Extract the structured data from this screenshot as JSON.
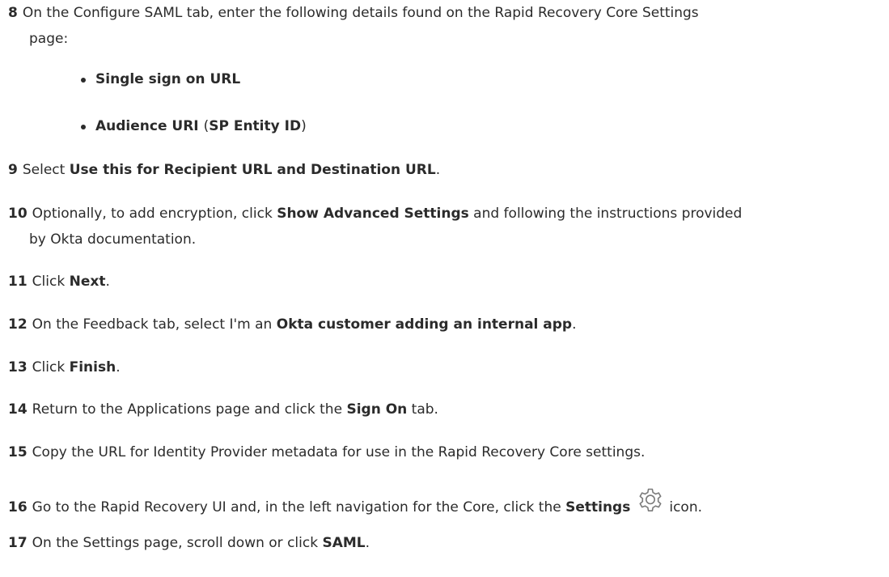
{
  "steps": {
    "s8": {
      "num": "8",
      "text": "On the Configure SAML tab, enter the following details found on the Rapid Recovery Core Settings",
      "cont": "page:"
    },
    "b1": {
      "text": "Single sign on URL"
    },
    "b2": {
      "pre": "Audience URI ",
      "paren_open": "(",
      "bold": "SP Entity ID",
      "paren_close": ")"
    },
    "s9": {
      "num": "9",
      "pre": "Select ",
      "bold": "Use this for Recipient URL and Destination URL",
      "post": "."
    },
    "s10": {
      "num": "10",
      "pre": "Optionally, to add encryption, click ",
      "bold": "Show Advanced Settings",
      "post": " and following the instructions provided",
      "cont": "by Okta documentation."
    },
    "s11": {
      "num": "11",
      "pre": "Click ",
      "bold": "Next",
      "post": "."
    },
    "s12": {
      "num": "12",
      "pre": "On the Feedback tab, select I'm an ",
      "bold": "Okta customer adding an internal app",
      "post": "."
    },
    "s13": {
      "num": "13",
      "pre": "Click ",
      "bold": "Finish",
      "post": "."
    },
    "s14": {
      "num": "14",
      "pre": "Return to the Applications page and click the ",
      "bold": "Sign On",
      "post": " tab."
    },
    "s15": {
      "num": "15",
      "text": "Copy the URL for Identity Provider metadata for use in the Rapid Recovery Core settings."
    },
    "s16": {
      "num": "16",
      "pre": "Go to the Rapid Recovery UI and, in the left navigation for the Core, click the ",
      "bold": "Settings",
      "post": "icon.",
      "icon": "gear-icon"
    },
    "s17": {
      "num": "17",
      "pre": "On the Settings page, scroll down or click ",
      "bold": "SAML",
      "post": "."
    }
  }
}
